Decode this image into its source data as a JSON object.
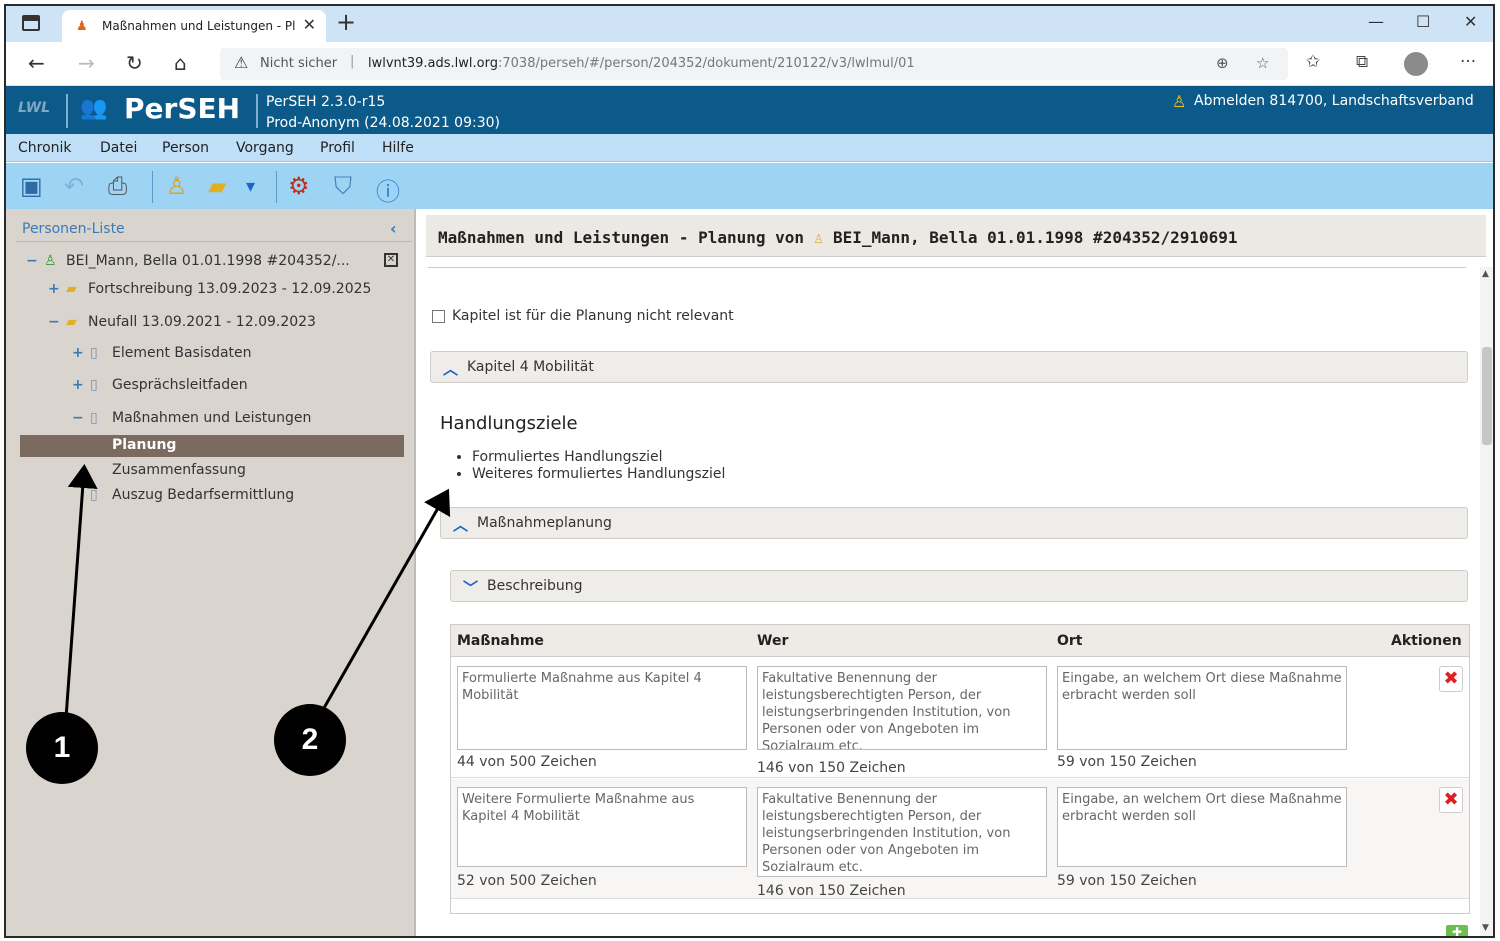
{
  "browser": {
    "tab_title": "Maßnahmen und Leistungen - Pl",
    "tab_close": "✕",
    "new_tab": "+",
    "window_controls": {
      "minimize": "—",
      "maximize": "☐",
      "close": "✕"
    },
    "nav": {
      "back": "←",
      "forward": "→",
      "reload": "↻",
      "home": "⌂"
    },
    "security_label": "Nicht sicher",
    "url_host": "lwlvnt39.ads.lwl.org",
    "url_path": ":7038/perseh/#/person/204352/dokument/210122/v3/lwlmul/01",
    "icons": {
      "zoom": "zoom-icon",
      "favorites-add": "star-plus-icon",
      "favorites": "favorites-icon",
      "collections": "collections-icon",
      "profile": "profile-icon",
      "more": "more-icon"
    }
  },
  "app": {
    "org_logo": "LWL",
    "brand": "PerSEH",
    "version_line1": "PerSEH 2.3.0-r15",
    "version_line2": "Prod-Anonym (24.08.2021 09:30)",
    "logout": "Abmelden 814700, Landschaftsverband"
  },
  "menu": [
    "Chronik",
    "Datei",
    "Person",
    "Vorgang",
    "Profil",
    "Hilfe"
  ],
  "toolbar": [
    "save-icon",
    "undo-icon",
    "print-icon",
    "person-icon",
    "folder-add-icon",
    "dropdown-icon",
    "network-icon",
    "document-shield-icon",
    "help-icon"
  ],
  "sidebar": {
    "title": "Personen-Liste",
    "collapse": "‹",
    "close": "✕",
    "tree": [
      {
        "toggle": "−",
        "icon": "♙",
        "label": "BEI_Mann, Bella 01.01.1998 #204352/..."
      },
      {
        "toggle": "+",
        "icon": "▰",
        "label": "Fortschreibung 13.09.2023 - 12.09.2025"
      },
      {
        "toggle": "−",
        "icon": "▰",
        "label": "Neufall 13.09.2021 - 12.09.2023"
      },
      {
        "toggle": "+",
        "icon": "▯",
        "label": "Element Basisdaten"
      },
      {
        "toggle": "+",
        "icon": "▯",
        "label": "Gesprächsleitfaden"
      },
      {
        "toggle": "−",
        "icon": "▯",
        "label": "Maßnahmen und Leistungen"
      },
      {
        "toggle": "",
        "icon": "",
        "label": "Planung"
      },
      {
        "toggle": "",
        "icon": "",
        "label": "Zusammenfassung"
      },
      {
        "toggle": "",
        "icon": "▯",
        "label": "Auszug Bedarfsermittlung"
      }
    ]
  },
  "main": {
    "title_prefix": "Maßnahmen und Leistungen - Planung von",
    "title_icon": "♙",
    "title_person": "BEI_Mann, Bella 01.01.1998 #204352/2910691",
    "checkbox_label": "Kapitel ist für die Planung nicht relevant",
    "chapter_bar": "Kapitel 4 Mobilität",
    "goals_heading": "Handlungsziele",
    "goals": [
      "Formuliertes Handlungsziel",
      "Weiteres formuliertes Handlungsziel"
    ],
    "massnahmen_bar": "Maßnahmeplanung",
    "beschreibung_bar": "Beschreibung",
    "chevron_up": "︿",
    "chevron_down": "﹀",
    "table": {
      "headers": {
        "massnahme": "Maßnahme",
        "wer": "Wer",
        "ort": "Ort",
        "aktionen": "Aktionen"
      },
      "delete_label": "✖",
      "rows": [
        {
          "massnahme": "Formulierte Maßnahme aus Kapitel 4 Mobilität",
          "massnahme_count": "44 von 500 Zeichen",
          "wer": "Fakultative Benennung der leistungsberechtigten Person, der leistungserbringenden Institution, von Personen oder von Angeboten im Sozialraum etc.",
          "wer_count": "146 von 150 Zeichen",
          "ort": "Eingabe, an welchem Ort diese Maßnahme erbracht werden soll",
          "ort_count": "59 von 150 Zeichen"
        },
        {
          "massnahme": "Weitere Formulierte Maßnahme aus Kapitel 4 Mobilität",
          "massnahme_count": "52 von 500 Zeichen",
          "wer": "Fakultative Benennung der leistungsberechtigten Person, der leistungserbringenden Institution, von Personen oder von Angeboten im Sozialraum etc.",
          "wer_count": "146 von 150 Zeichen",
          "ort": "Eingabe, an welchem Ort diese Maßnahme erbracht werden soll",
          "ort_count": "59 von 150 Zeichen"
        }
      ],
      "add_label": "✚"
    }
  },
  "annotations": {
    "callout_1": "1",
    "callout_2": "2"
  }
}
